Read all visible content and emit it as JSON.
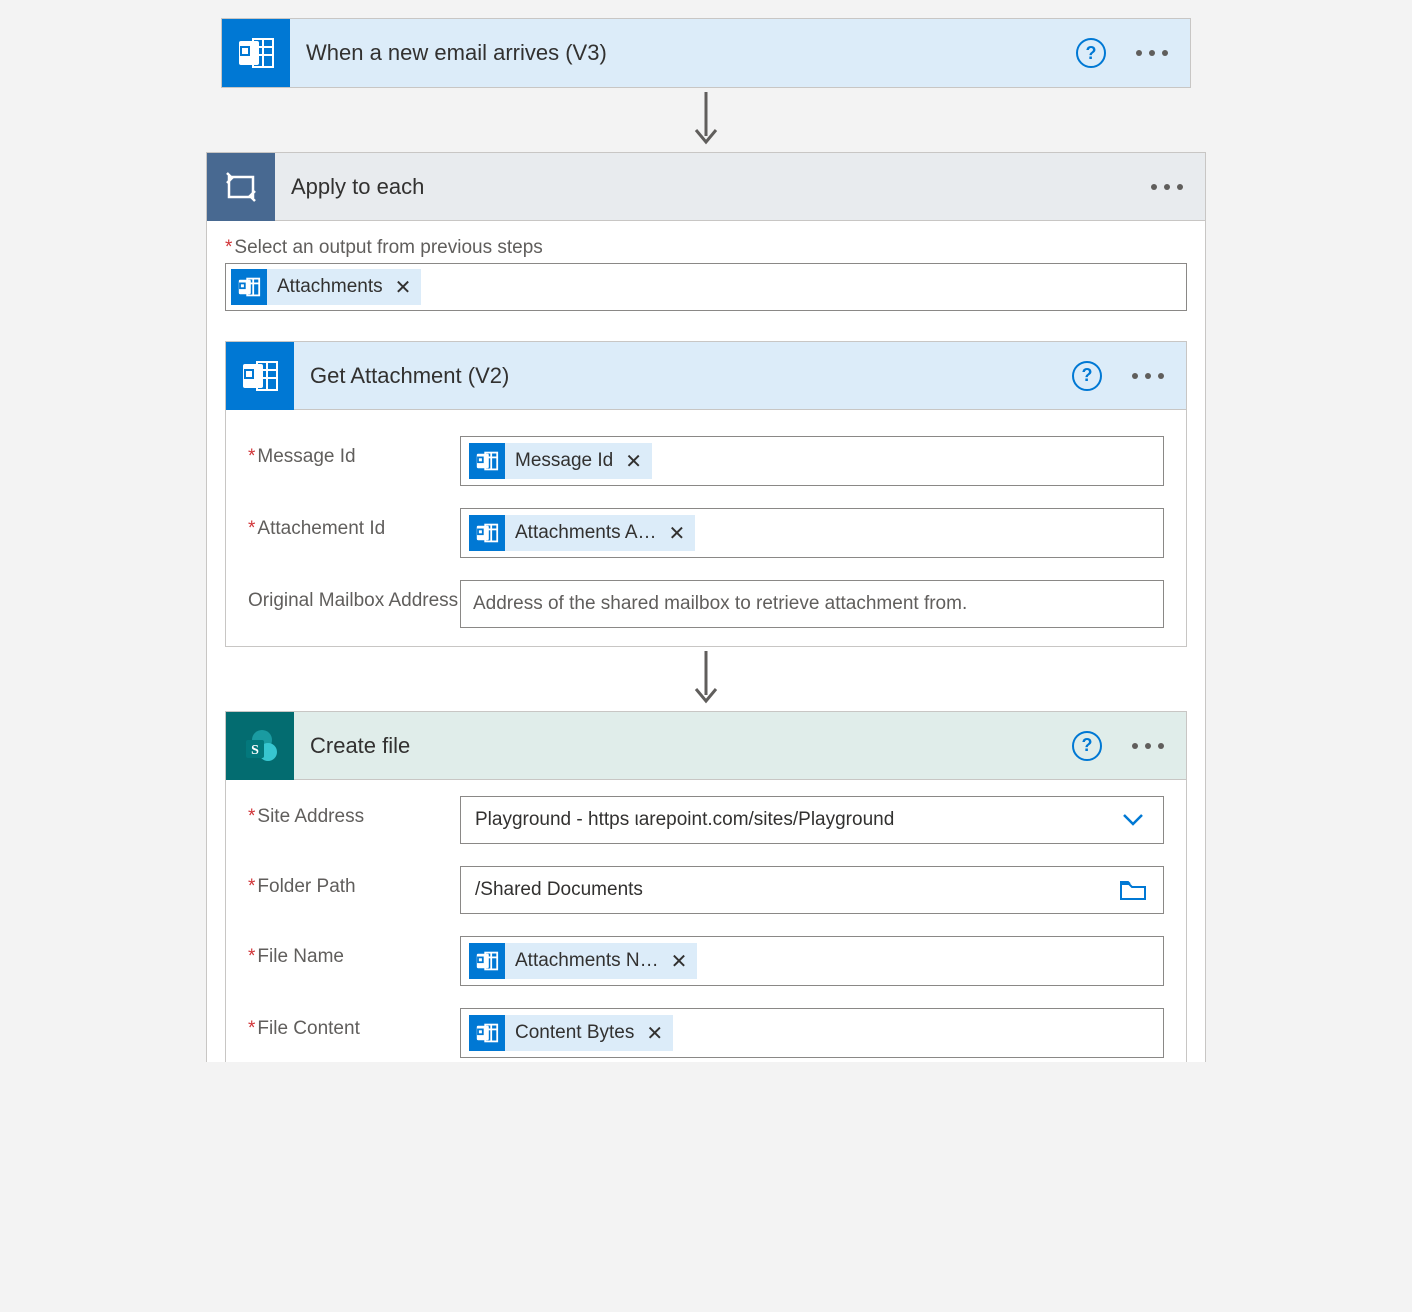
{
  "trigger": {
    "title": "When a new email arrives (V3)"
  },
  "apply_to_each": {
    "title": "Apply to each",
    "select_label": "Select an output from previous steps",
    "select_token": "Attachments"
  },
  "get_attachment": {
    "title": "Get Attachment (V2)",
    "fields": {
      "message_id": {
        "label": "Message Id",
        "token": "Message Id"
      },
      "attachment_id": {
        "label": "Attachement Id",
        "token": "Attachments A…"
      },
      "mailbox": {
        "label": "Original Mailbox Address",
        "placeholder": "Address of the shared mailbox to retrieve attachment from."
      }
    }
  },
  "create_file": {
    "title": "Create file",
    "fields": {
      "site": {
        "label": "Site Address",
        "value": "Playground - https                           ιarepoint.com/sites/Playground"
      },
      "folder": {
        "label": "Folder Path",
        "value": "/Shared Documents"
      },
      "file_name": {
        "label": "File Name",
        "token": "Attachments N…"
      },
      "file_content": {
        "label": "File Content",
        "token": "Content Bytes"
      }
    }
  }
}
